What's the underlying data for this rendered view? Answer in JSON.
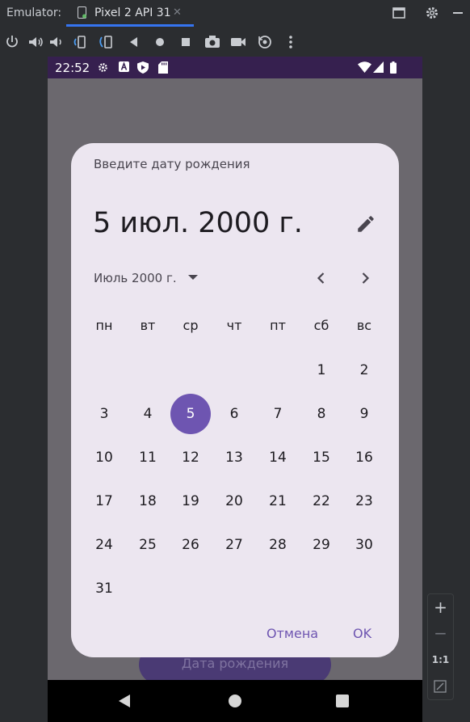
{
  "ide": {
    "tab_prefix": "Emulator:",
    "tab_label": "Pixel 2 API 31",
    "tab_close": "✕",
    "window_icons": [
      "restore-window-icon",
      "gear-icon",
      "minimize-icon"
    ],
    "toolbar_icons": [
      "power-icon",
      "volume-up-icon",
      "volume-down-icon",
      "rotate-left-icon",
      "rotate-right-icon",
      "back-icon",
      "home-icon",
      "overview-icon",
      "camera-icon",
      "video-icon",
      "snapshot-icon",
      "more-icon"
    ],
    "zoom_panel": {
      "plus": "+",
      "minus": "−",
      "one_to_one": "1:1"
    }
  },
  "status_bar": {
    "time": "22:52"
  },
  "app": {
    "button_label": "Дата рождения"
  },
  "dialog": {
    "headline_small": "Введите дату рождения",
    "selected_date": "5 июл. 2000 г.",
    "month_label": "Июль 2000 г.",
    "weekdays": [
      "пн",
      "вт",
      "ср",
      "чт",
      "пт",
      "сб",
      "вс"
    ],
    "days": [
      "1",
      "2",
      "3",
      "4",
      "5",
      "6",
      "7",
      "8",
      "9",
      "10",
      "11",
      "12",
      "13",
      "14",
      "15",
      "16",
      "17",
      "18",
      "19",
      "20",
      "21",
      "22",
      "23",
      "24",
      "25",
      "26",
      "27",
      "28",
      "29",
      "30",
      "31"
    ],
    "first_weekday_index": 5,
    "selected_day": "5",
    "cancel_label": "Отмена",
    "ok_label": "OK"
  },
  "colors": {
    "accent": "#6e55b1",
    "dialog_bg": "#ece6f0",
    "status_bar": "#36204f",
    "ide_tab_underline": "#3574f0"
  }
}
